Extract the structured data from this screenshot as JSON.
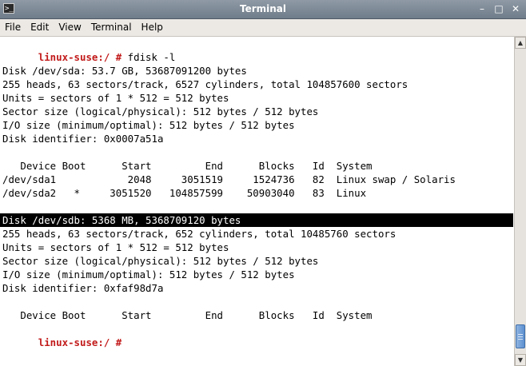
{
  "window": {
    "title": "Terminal",
    "controls": {
      "minimize": "–",
      "maximize": "□",
      "close": "✕"
    },
    "app_icon": ">_"
  },
  "menubar": {
    "items": [
      "File",
      "Edit",
      "View",
      "Terminal",
      "Help"
    ]
  },
  "terminal": {
    "prompt": "linux-suse:/ #",
    "command": " fdisk -l",
    "lines": [
      "",
      "Disk /dev/sda: 53.7 GB, 53687091200 bytes",
      "255 heads, 63 sectors/track, 6527 cylinders, total 104857600 sectors",
      "Units = sectors of 1 * 512 = 512 bytes",
      "Sector size (logical/physical): 512 bytes / 512 bytes",
      "I/O size (minimum/optimal): 512 bytes / 512 bytes",
      "Disk identifier: 0x0007a51a",
      "",
      "   Device Boot      Start         End      Blocks   Id  System",
      "/dev/sda1            2048     3051519     1524736   82  Linux swap / Solaris",
      "/dev/sda2   *     3051520   104857599    50903040   83  Linux",
      "",
      "Disk /dev/sdb: 5368 MB, 5368709120 bytes",
      "255 heads, 63 sectors/track, 652 cylinders, total 10485760 sectors",
      "Units = sectors of 1 * 512 = 512 bytes",
      "Sector size (logical/physical): 512 bytes / 512 bytes",
      "I/O size (minimum/optimal): 512 bytes / 512 bytes",
      "Disk identifier: 0xfaf98d7a",
      "",
      "   Device Boot      Start         End      Blocks   Id  System"
    ],
    "selected_line": "Disk /dev/sdb: 5368 MB, 5368709120 bytes",
    "final_prompt": "linux-suse:/ #"
  },
  "colors": {
    "prompt": "#c21a1a",
    "selection_bg": "#000000",
    "selection_fg": "#ffffff",
    "titlebar": "#7f8a96"
  },
  "scrollbar": {
    "up_icon": "▲",
    "down_icon": "▼"
  }
}
